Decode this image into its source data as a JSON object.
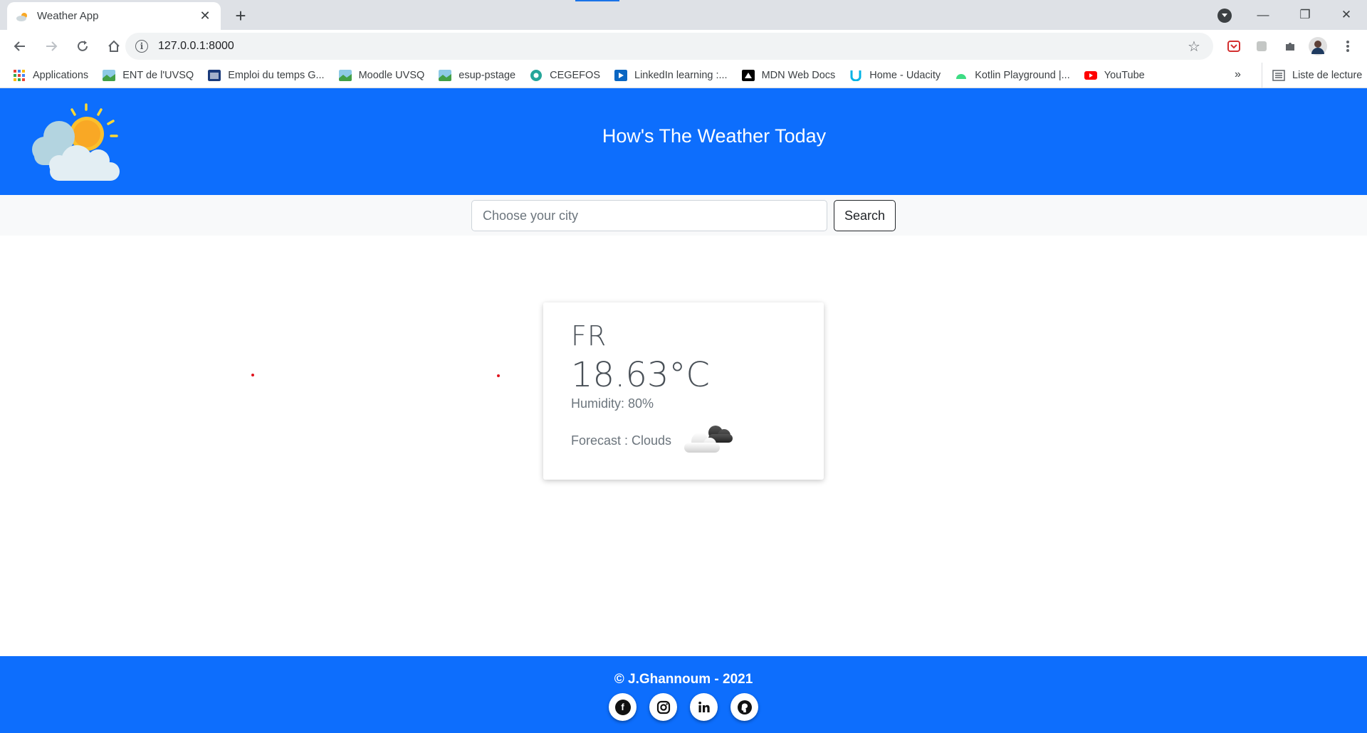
{
  "browser": {
    "tab_title": "Weather App",
    "url": "127.0.0.1:8000",
    "bookmarks": [
      {
        "label": "Applications",
        "icon": "apps-grid-icon"
      },
      {
        "label": "ENT de l'UVSQ",
        "icon": "landscape-icon"
      },
      {
        "label": "Emploi du temps G...",
        "icon": "calendar-icon"
      },
      {
        "label": "Moodle UVSQ",
        "icon": "landscape-icon"
      },
      {
        "label": "esup-pstage",
        "icon": "landscape-icon"
      },
      {
        "label": "CEGEFOS",
        "icon": "cegefos-icon"
      },
      {
        "label": "LinkedIn learning :...",
        "icon": "play-icon"
      },
      {
        "label": "MDN Web Docs",
        "icon": "mdn-icon"
      },
      {
        "label": "Home - Udacity",
        "icon": "udacity-icon"
      },
      {
        "label": "Kotlin Playground |...",
        "icon": "android-icon"
      },
      {
        "label": "YouTube",
        "icon": "youtube-icon"
      }
    ],
    "more_bookmarks": "»",
    "reading_list": "Liste de lecture"
  },
  "header": {
    "title": "How's The Weather Today"
  },
  "search": {
    "placeholder": "Choose your city",
    "button_label": "Search"
  },
  "weather": {
    "country": "FR",
    "temperature": "18.63°C",
    "humidity": "Humidity: 80%",
    "forecast": "Forecast : Clouds",
    "forecast_icon": "clouds-icon"
  },
  "footer": {
    "copyright": "© J.Ghannoum - 2021",
    "socials": [
      "facebook-icon",
      "instagram-icon",
      "linkedin-icon",
      "github-icon"
    ]
  },
  "colors": {
    "brand_blue": "#0d6efd",
    "search_bg": "#f8f9fa",
    "text_dark": "#495057"
  }
}
